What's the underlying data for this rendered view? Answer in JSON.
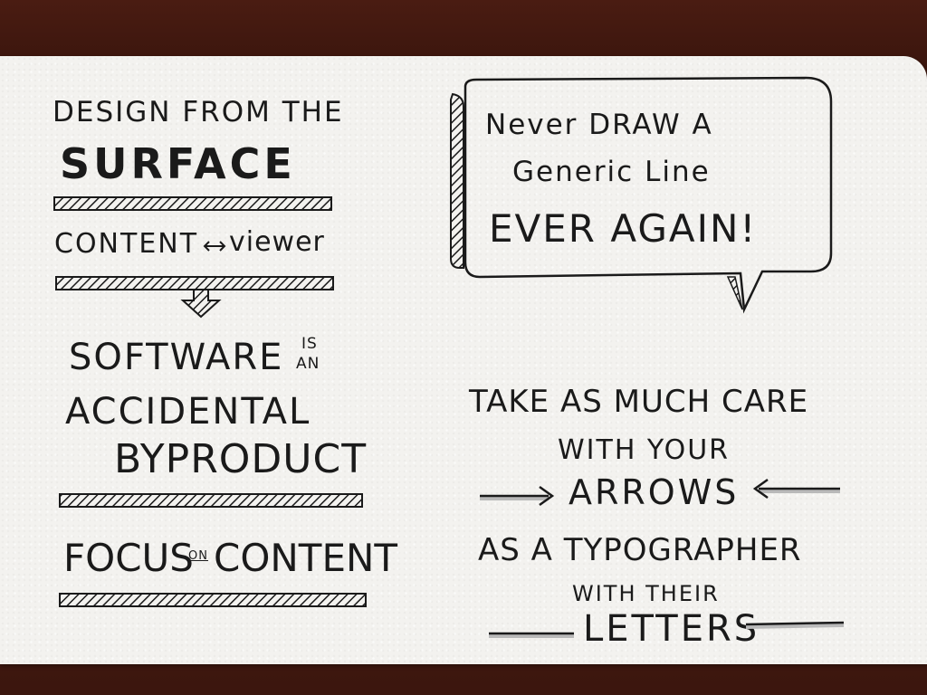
{
  "left": {
    "line1": "DESIGN FROM THE",
    "line2": "SURFACE",
    "content_viewer_a": "CONTENT",
    "content_viewer_b": "viewer",
    "software_a": "SOFTWARE",
    "software_is": "IS",
    "software_an": "AN",
    "accidental": "ACCIDENTAL",
    "byproduct": "BYPRODUCT",
    "focus_a": "FOCUS",
    "focus_on": "ON",
    "focus_b": "CONTENT"
  },
  "bubble": {
    "line1": "Never DRAW A",
    "line2": "Generic Line",
    "line3": "EVER AGAIN!"
  },
  "right": {
    "line1": "TAKE AS MUCH CARE",
    "line2": "WITH YOUR",
    "line3": "ARROWS",
    "line4": "AS A TYPOGRAPHER",
    "line5": "WITH THEIR",
    "line6": "LETTERS"
  },
  "colors": {
    "ink": "#1a1a1a",
    "paper": "#f3f2ef",
    "wood": "#4a1c12",
    "marker_gray": "#b9b9b9"
  }
}
